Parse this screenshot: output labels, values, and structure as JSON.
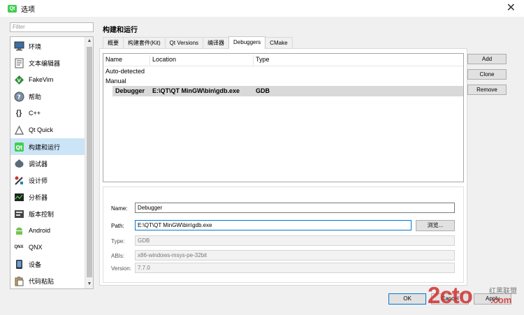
{
  "window": {
    "title": "选项",
    "app_icon": "Qt"
  },
  "filter": {
    "placeholder": "Filter"
  },
  "sidebar": {
    "items": [
      {
        "label": "环境",
        "icon": "monitor-icon"
      },
      {
        "label": "文本编辑器",
        "icon": "text-editor-icon"
      },
      {
        "label": "FakeVim",
        "icon": "fakevim-icon"
      },
      {
        "label": "帮助",
        "icon": "help-icon"
      },
      {
        "label": "C++",
        "icon": "cpp-braces-icon"
      },
      {
        "label": "Qt Quick",
        "icon": "qt-quick-icon"
      },
      {
        "label": "构建和运行",
        "icon": "build-run-icon",
        "selected": true
      },
      {
        "label": "调试器",
        "icon": "debugger-icon"
      },
      {
        "label": "设计师",
        "icon": "designer-icon"
      },
      {
        "label": "分析器",
        "icon": "analyzer-icon"
      },
      {
        "label": "版本控制",
        "icon": "version-control-icon"
      },
      {
        "label": "Android",
        "icon": "android-icon"
      },
      {
        "label": "QNX",
        "icon": "qnx-icon"
      },
      {
        "label": "设备",
        "icon": "device-icon"
      },
      {
        "label": "代码粘贴",
        "icon": "code-paste-icon"
      }
    ]
  },
  "page": {
    "title": "构建和运行"
  },
  "tabs": [
    {
      "label": "概要"
    },
    {
      "label": "构建套件(Kit)"
    },
    {
      "label": "Qt Versions"
    },
    {
      "label": "编译器"
    },
    {
      "label": "Debuggers",
      "active": true
    },
    {
      "label": "CMake"
    }
  ],
  "tree": {
    "columns": [
      "Name",
      "Location",
      "Type"
    ],
    "groups": [
      "Auto-detected",
      "Manual"
    ],
    "selected_row": {
      "name": "Debugger",
      "location": "E:\\QT\\QT MinGW\\bin\\gdb.exe",
      "type": "GDB"
    }
  },
  "side_buttons": {
    "add": "Add",
    "clone": "Clone",
    "remove": "Remove"
  },
  "details": {
    "name_label": "Name:",
    "name_value": "Debugger",
    "path_label": "Path:",
    "path_value": "E:\\QT\\QT MinGW\\bin\\gdb.exe",
    "browse_label": "浏览...",
    "type_label": "Type:",
    "type_value": "GDB",
    "abis_label": "ABIs:",
    "abis_value": "x86-windows-msys-pe-32bit",
    "version_label": "Version:",
    "version_value": "7.7.0"
  },
  "dialog_buttons": {
    "ok": "OK",
    "cancel": "Cancel",
    "apply": "Apply"
  },
  "watermark": {
    "text": "2cto",
    "suffix": ".com",
    "sub": "红黑联盟"
  },
  "colors": {
    "selection": "#cce4f7",
    "accent": "#0078d7",
    "qt_green": "#41cd52",
    "watermark_red": "#d32f2f"
  }
}
